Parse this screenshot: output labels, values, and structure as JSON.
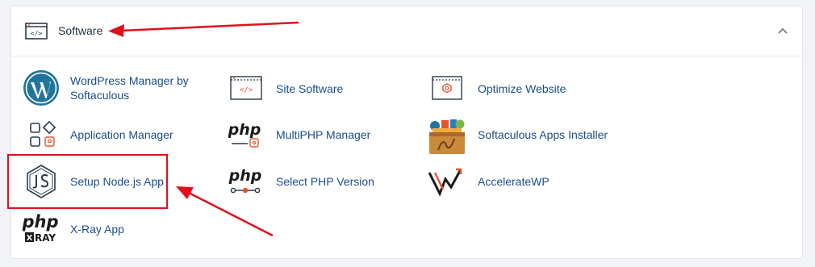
{
  "section": {
    "title": "Software",
    "collapse_icon": "chevron-up-icon"
  },
  "items": [
    {
      "label": "WordPress Manager by",
      "label2": "Softaculous",
      "icon": "wordpress-icon"
    },
    {
      "label": "Site Software",
      "icon": "code-window-icon"
    },
    {
      "label": "Optimize Website",
      "icon": "optimize-gear-icon"
    },
    {
      "label": "Application Manager",
      "icon": "app-grid-icon"
    },
    {
      "label": "MultiPHP Manager",
      "icon": "php-gear-icon"
    },
    {
      "label": "Softaculous Apps Installer",
      "icon": "softaculous-box-icon"
    },
    {
      "label": "Setup Node.js App",
      "icon": "nodejs-icon"
    },
    {
      "label": "Select PHP Version",
      "icon": "php-slider-icon"
    },
    {
      "label": "AccelerateWP",
      "icon": "acceleratewp-icon"
    },
    {
      "label": "X-Ray App",
      "icon": "php-xray-icon"
    }
  ],
  "icon_text": {
    "php": "php",
    "xray": "RAY",
    "xray_x": "X",
    "code": "</>"
  },
  "colors": {
    "link": "#1a4c8c",
    "icon_dark": "#293a4a",
    "icon_accent": "#f47b20",
    "wordpress": "#21759b",
    "annotation_red": "#e0111b"
  }
}
